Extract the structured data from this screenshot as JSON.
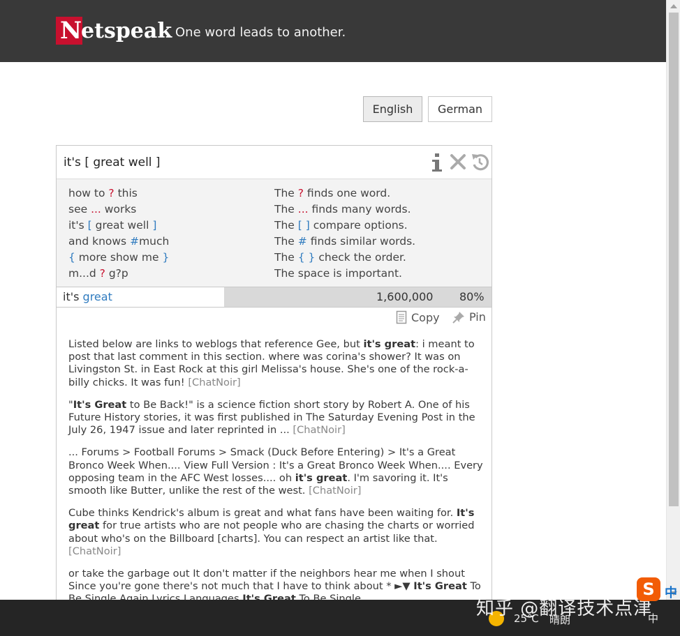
{
  "header": {
    "logo_n": "N",
    "logo_rest": "etspeak",
    "tagline": "One word leads to another."
  },
  "languages": [
    "English",
    "German"
  ],
  "search": {
    "value": "it's [ great well ]"
  },
  "help": {
    "examples": [
      {
        "pre": "how to ",
        "op": "?",
        "post": " this",
        "op_color": "red"
      },
      {
        "pre": "see ",
        "op": "...",
        "post": " works",
        "op_color": "red"
      },
      {
        "pre": "it's ",
        "op": "[",
        "mid": " great well ",
        "op2": "]",
        "op_color": "blue"
      },
      {
        "pre": "and knows ",
        "op": "#",
        "post": "much",
        "op_color": "blue"
      },
      {
        "pre": "",
        "op": "{",
        "mid": " more show me ",
        "op2": "}",
        "op_color": "blue"
      },
      {
        "pre": "m...d ",
        "op": "?",
        "post": " g?p",
        "op_color": "red"
      }
    ],
    "explanations": [
      {
        "pre": "The ",
        "op": "?",
        "post": " finds one word.",
        "op_color": "red"
      },
      {
        "pre": "The ",
        "op": "...",
        "post": " finds many words.",
        "op_color": "red"
      },
      {
        "pre": "The ",
        "op": "[ ]",
        "post": " compare options.",
        "op_color": "blue"
      },
      {
        "pre": "The ",
        "op": "#",
        "post": " finds similar words.",
        "op_color": "blue"
      },
      {
        "pre": "The ",
        "op": "{ }",
        "post": " check the order.",
        "op_color": "blue"
      },
      {
        "pre": "The space is important.",
        "op": "",
        "post": "",
        "op_color": "none"
      }
    ]
  },
  "result": {
    "phrase_prefix": "it's ",
    "phrase_highlight": "great",
    "count": "1,600,000",
    "percent": "80%",
    "relative_frequency": 0.8
  },
  "actions": {
    "copy": "Copy",
    "pin": "Pin"
  },
  "snippets": [
    [
      {
        "t": "Listed below are links to weblogs that reference Gee, but "
      },
      {
        "t": "it's great",
        "b": true
      },
      {
        "t": ": i meant to post that last comment in this section. where was corina's shower? It was on Livingston St. in East Rock at this girl Melissa's house. She's one of the rock-a-billy chicks. It was fun! "
      },
      {
        "t": "[ChatNoir]",
        "src": true
      }
    ],
    [
      {
        "t": "\""
      },
      {
        "t": "It's Great",
        "b": true
      },
      {
        "t": " to Be Back!\" is a science fiction short story by Robert A. One of his Future History stories, it was first published in The Saturday Evening Post in the July 26, 1947 issue and later reprinted in ... "
      },
      {
        "t": "[ChatNoir]",
        "src": true
      }
    ],
    [
      {
        "t": "... Forums > Football Forums > Smack (Duck Before Entering) > It's a Great Bronco Week When.... View Full Version : It's a Great Bronco Week When.... Every opposing team in the AFC West losses.... oh "
      },
      {
        "t": "it's great",
        "b": true
      },
      {
        "t": ". I'm savoring it. It's smooth like Butter, unlike the rest of the west. "
      },
      {
        "t": "[ChatNoir]",
        "src": true
      }
    ],
    [
      {
        "t": "Cube thinks Kendrick's album is great and what fans have been waiting for. "
      },
      {
        "t": "It's great",
        "b": true
      },
      {
        "t": " for true artists who are not people who are chasing the charts or worried about who's on the Billboard [charts]. You can respect an artist like that. "
      },
      {
        "t": "[ChatNoir]",
        "src": true
      }
    ],
    [
      {
        "t": "or take the garbage out It don't matter if the neighbors hear me when I shout Since you're gone there's not much that I have to think about * ►▼ "
      },
      {
        "t": "It's Great",
        "b": true
      },
      {
        "t": " To Be Single Again Lyrics Languages "
      },
      {
        "t": "It's Great",
        "b": true
      },
      {
        "t": " To Be Single"
      }
    ]
  ],
  "taskbar": {
    "temperature": "25℃",
    "weather": "晴朗",
    "ime": "中",
    "watermark": "知乎 @翻译技术点津",
    "sogou_logo": "S",
    "sogou_mode": "中"
  },
  "icons": {
    "info": "info-icon",
    "clear": "close-icon",
    "undo": "undo-icon",
    "copy": "copy-icon",
    "pin": "pin-icon"
  },
  "colors": {
    "header_bg": "#393939",
    "brand_red": "#c8102e",
    "operator_blue": "#2f7bbf",
    "help_bg": "#f3f3f3",
    "frequency_bar": "#d9d9d9"
  }
}
